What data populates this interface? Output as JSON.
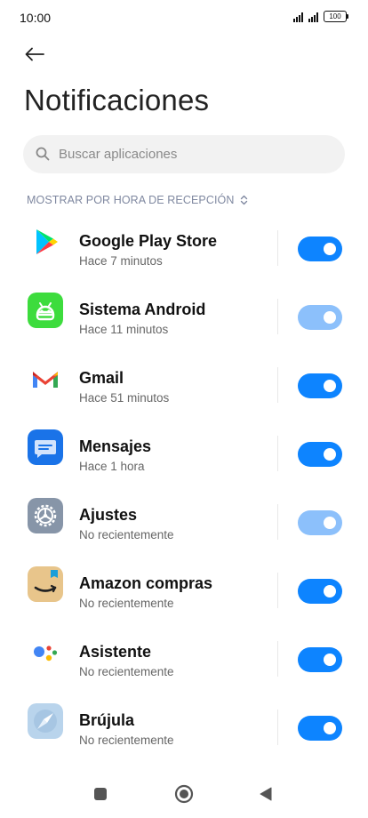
{
  "status_bar": {
    "time": "10:00",
    "battery": "100"
  },
  "header": {
    "title": "Notificaciones"
  },
  "search": {
    "placeholder": "Buscar aplicaciones"
  },
  "sort": {
    "label": "MOSTRAR POR HORA DE RECEPCIÓN"
  },
  "apps": [
    {
      "name": "Google Play Store",
      "subtitle": "Hace 7 minutos",
      "enabled": true,
      "dimmed": false,
      "icon": "google-play-store-icon"
    },
    {
      "name": "Sistema Android",
      "subtitle": "Hace 11 minutos",
      "enabled": true,
      "dimmed": true,
      "icon": "android-system-icon"
    },
    {
      "name": "Gmail",
      "subtitle": "Hace 51 minutos",
      "enabled": true,
      "dimmed": false,
      "icon": "gmail-icon"
    },
    {
      "name": "Mensajes",
      "subtitle": "Hace 1 hora",
      "enabled": true,
      "dimmed": false,
      "icon": "messages-icon"
    },
    {
      "name": "Ajustes",
      "subtitle": "No recientemente",
      "enabled": true,
      "dimmed": true,
      "icon": "settings-icon"
    },
    {
      "name": "Amazon compras",
      "subtitle": "No recientemente",
      "enabled": true,
      "dimmed": false,
      "icon": "amazon-icon"
    },
    {
      "name": "Asistente",
      "subtitle": "No recientemente",
      "enabled": true,
      "dimmed": false,
      "icon": "assistant-icon"
    },
    {
      "name": "Brújula",
      "subtitle": "No recientemente",
      "enabled": true,
      "dimmed": false,
      "icon": "compass-icon"
    }
  ],
  "colors": {
    "accent": "#0d84ff",
    "accent_dim": "#8cc0fb"
  }
}
